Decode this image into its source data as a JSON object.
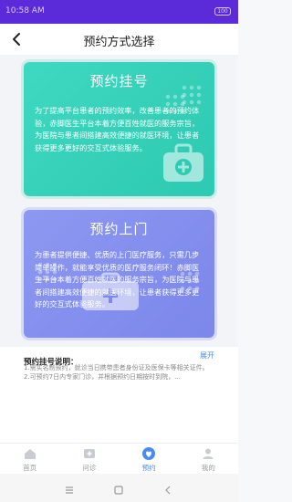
{
  "status_bar": {
    "time": "10:58 AM",
    "battery": "100"
  },
  "header": {
    "title": "预约方式选择"
  },
  "cards": [
    {
      "title": "预约挂号",
      "description": "为了提高平台患者的预约效率，改善患者的预约体验，赤脚医生平台本着方便百姓就医的服务宗旨，为医院与患者间搭建高效便捷的就医环境，让患者获得更多更好的交互式体验服务。",
      "icon": "hospital-bag-icon"
    },
    {
      "title": "预约上门",
      "description": "为患者提供便捷、优质的上门医疗服务，只需几步简单操作，就能享受优质的医疗服务闭环！赤脚医生平台本着方便百姓就医的服务宗旨，为医院与患者间搭建高效便捷的就医环境，让患者获得更多更好的交互式体验服务。",
      "icon": "medical-case-icon"
    }
  ],
  "info": {
    "title": "预约挂号说明：",
    "toggle": "展开",
    "lines": [
      "1.需实名制预约，就诊当日携带患者身份证及医保卡等相关证件。",
      "2.可预约7日内专家门诊，并根据预约日期按时到院，..."
    ]
  },
  "tabs": [
    {
      "label": "首页",
      "icon": "home-icon",
      "active": false
    },
    {
      "label": "问诊",
      "icon": "consult-icon",
      "active": false
    },
    {
      "label": "预约",
      "icon": "appointment-icon",
      "active": true
    },
    {
      "label": "我的",
      "icon": "profile-icon",
      "active": false
    }
  ],
  "colors": {
    "status_bar": "#5b2bd9",
    "card_green": "#2ec9b2",
    "card_blue": "#7b87ea",
    "accent": "#4a8af4"
  }
}
